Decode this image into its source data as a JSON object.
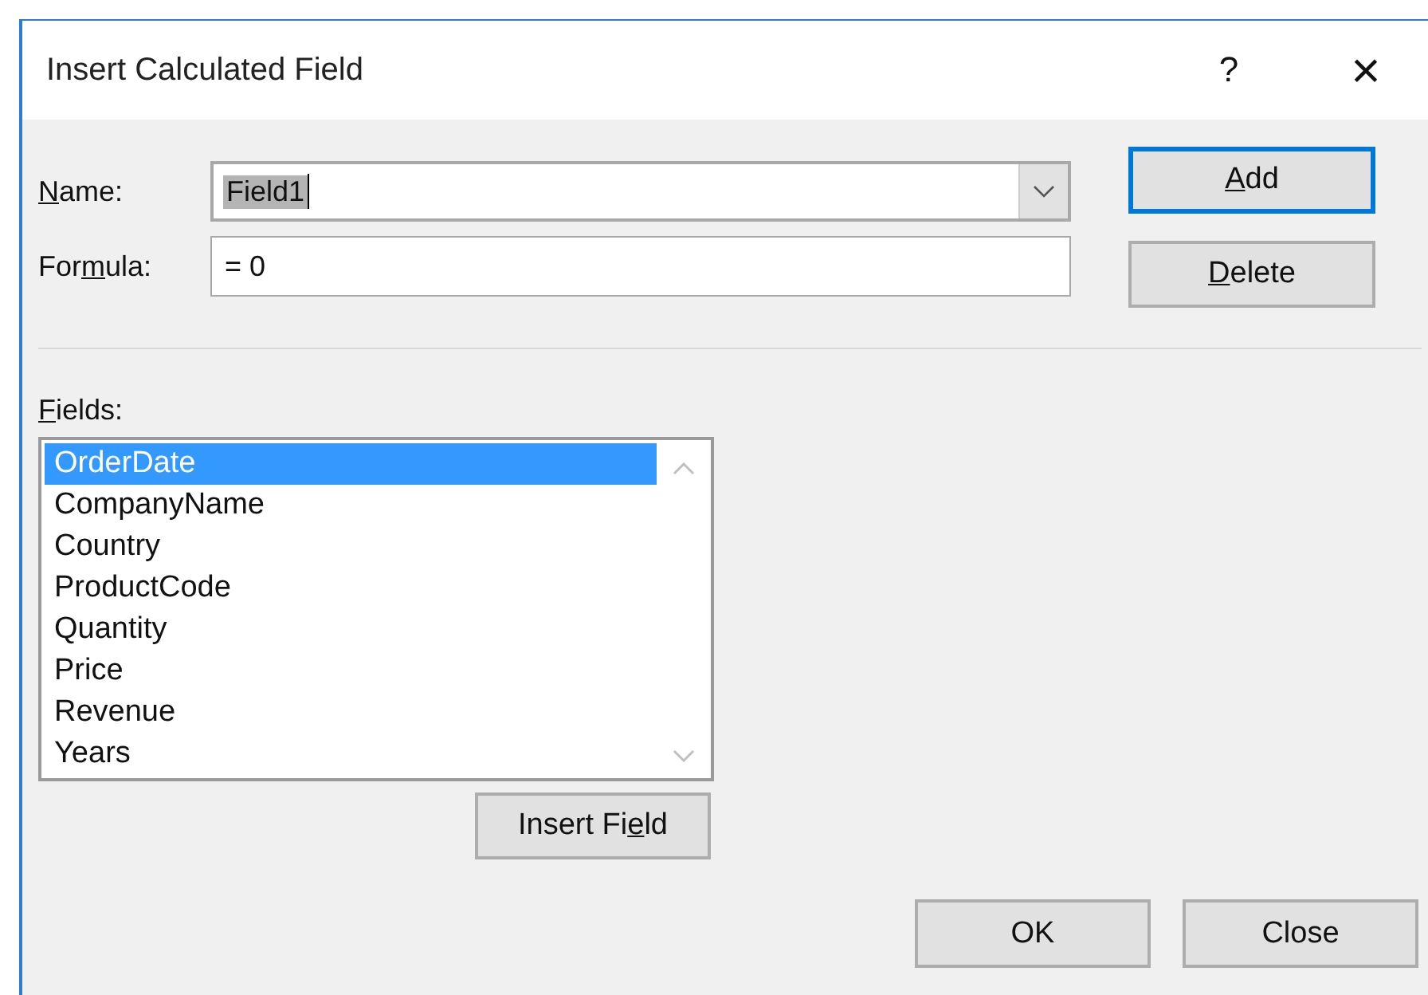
{
  "window": {
    "title": "Insert Calculated Field",
    "help": "?",
    "close": "×"
  },
  "name": {
    "label": [
      {
        "text": "N",
        "key": true
      },
      {
        "text": "ame:"
      }
    ],
    "value": "Field1",
    "highlighted": true
  },
  "formula": {
    "label": [
      {
        "text": "For"
      },
      {
        "text": "m",
        "key": true
      },
      {
        "text": "ula:"
      }
    ],
    "value": "= 0"
  },
  "side_buttons": [
    {
      "label": [
        {
          "text": "A",
          "key": true
        },
        {
          "text": "dd"
        }
      ],
      "default": true
    },
    {
      "label": [
        {
          "text": "D",
          "key": true
        },
        {
          "text": "elete"
        }
      ],
      "default": false
    }
  ],
  "fields": {
    "label": [
      {
        "text": "F",
        "key": true
      },
      {
        "text": "ields:"
      }
    ],
    "items": [
      {
        "text": "OrderDate",
        "selected": true
      },
      {
        "text": "CompanyName",
        "selected": false
      },
      {
        "text": "Country",
        "selected": false
      },
      {
        "text": "ProductCode",
        "selected": false
      },
      {
        "text": "Quantity",
        "selected": false
      },
      {
        "text": "Price",
        "selected": false
      },
      {
        "text": "Revenue",
        "selected": false
      },
      {
        "text": "Years",
        "selected": false
      }
    ]
  },
  "insert_button": {
    "label": [
      {
        "text": "Insert Fi"
      },
      {
        "text": "e",
        "key": true
      },
      {
        "text": "ld"
      }
    ]
  },
  "buttons": [
    {
      "label": [
        {
          "text": "OK"
        }
      ]
    },
    {
      "label": [
        {
          "text": "Close"
        }
      ]
    }
  ]
}
